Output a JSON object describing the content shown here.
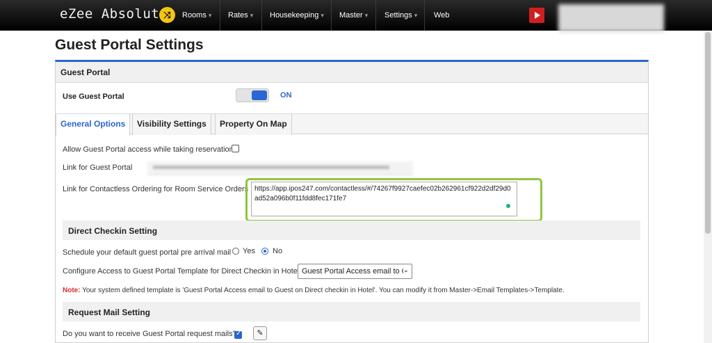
{
  "app": {
    "brand": "eZee Absolute",
    "badge_glyph": "⤨",
    "accent": "#2b66d1"
  },
  "nav": {
    "items": [
      {
        "label": "Rooms",
        "has_menu": true
      },
      {
        "label": "Rates",
        "has_menu": true
      },
      {
        "label": "Housekeeping",
        "has_menu": true
      },
      {
        "label": "Master",
        "has_menu": true
      },
      {
        "label": "Settings",
        "has_menu": true
      },
      {
        "label": "Web",
        "has_menu": false
      }
    ],
    "caret": "▾",
    "youtube_icon": "youtube-icon"
  },
  "page": {
    "title": "Guest Portal Settings"
  },
  "panel": {
    "title": "Guest Portal",
    "use_label": "Use Guest Portal",
    "toggle_state": "ON",
    "tabs": [
      {
        "label": "General Options",
        "active": true
      },
      {
        "label": "Visibility Settings",
        "active": false
      },
      {
        "label": "Property On Map",
        "active": false
      }
    ]
  },
  "general": {
    "allow_label": "Allow Guest Portal access while taking reservation",
    "allow_checked": false,
    "link_label": "Link for Guest Portal",
    "contactless_label": "Link for Contactless Ordering for Room Service Orders",
    "contactless_value": "https://app.ipos247.com/contactless/#/74267f9927caefec02b262961cf922d2df29d0ad52a096b0f11fdd8fec171fe7"
  },
  "direct_checkin": {
    "title": "Direct Checkin Setting",
    "schedule_label": "Schedule your default guest portal pre arrival mail",
    "yes_label": "Yes",
    "no_label": "No",
    "selected": "No",
    "configure_label": "Configure Access to Guest Portal Template for Direct Checkin in Hotel",
    "template_value": "Guest Portal Access email to C",
    "note_prefix": "Note:",
    "note_text": " Your system defined template is 'Guest Portal Access email to Guest on Direct checkin in Hotel'. You can modify it from Master->Email Templates->Template."
  },
  "request_mail": {
    "title": "Request Mail Setting",
    "receive_label": "Do you want to receive Guest Portal request mails?",
    "receive_checked": true,
    "edit_icon": "pencil-icon"
  }
}
